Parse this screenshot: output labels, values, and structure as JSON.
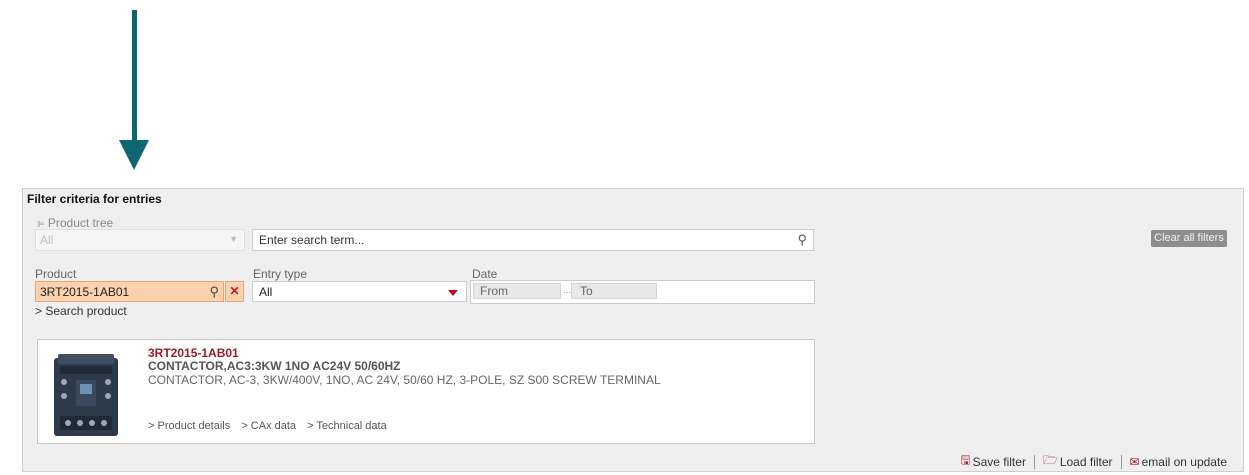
{
  "panel": {
    "title": "Filter criteria for entries",
    "product_tree_label": "Product tree",
    "product_tree_value": "All",
    "search": {
      "placeholder": "Enter search term..."
    },
    "clear_all_label": "Clear all filters",
    "product_label": "Product",
    "product_value": "3RT2015-1AB01",
    "search_product_link": "Search product",
    "entry_type_label": "Entry type",
    "entry_type_value": "All",
    "date_label": "Date",
    "date_from": "From",
    "date_to": "To"
  },
  "product": {
    "id": "3RT2015-1AB01",
    "name": "CONTACTOR,AC3:3KW 1NO AC24V 50/60HZ",
    "description": "CONTACTOR, AC-3, 3KW/400V, 1NO, AC 24V, 50/60 HZ, 3-POLE, SZ S00 SCREW TERMINAL",
    "links": [
      "Product details",
      "CAx data",
      "Technical data"
    ]
  },
  "actions": {
    "save_filter": "Save filter",
    "load_filter": "Load filter",
    "email_on_update": "email on update"
  },
  "colors": {
    "arrow": "#0e6672",
    "accent_red": "#b01028",
    "product_highlight": "#fcd2ae",
    "product_id": "#9b1d2a"
  },
  "icons": [
    "arrow-down-icon",
    "tree-icon",
    "chevron-down-icon",
    "search-icon",
    "close-icon",
    "save-icon",
    "folder-open-icon",
    "envelope-icon"
  ]
}
